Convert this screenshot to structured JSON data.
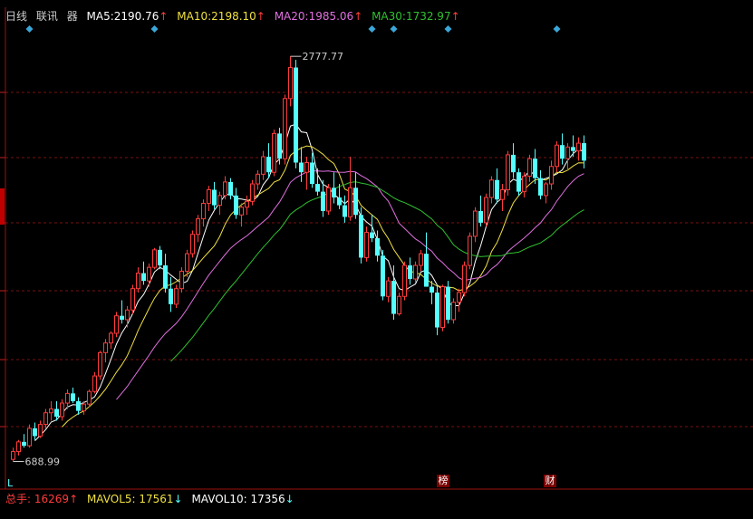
{
  "header": {
    "period": "日线",
    "source": "联讯",
    "tool": "器",
    "ma5": {
      "label": "MA5:",
      "value": "2190.76",
      "arrow": "↑",
      "color": "#ffffff"
    },
    "ma10": {
      "label": "MA10:",
      "value": "2198.10",
      "arrow": "↑",
      "color": "#f0e040"
    },
    "ma20": {
      "label": "MA20:",
      "value": "1985.06",
      "arrow": "↑",
      "color": "#e070e0"
    },
    "ma30": {
      "label": "MA30:",
      "value": "1732.97",
      "arrow": "↑",
      "color": "#30c030"
    }
  },
  "footer": {
    "vol_label": "总手:",
    "vol_value": "16269",
    "vol_arrow": "↑",
    "mavol5": "MAVOL5: 17561",
    "mavol5_arrow": "↓",
    "mavol10": "MAVOL10: 17356",
    "mavol10_arrow": "↓"
  },
  "markers": {
    "bang": "榜",
    "cai": "财"
  },
  "corner": "L",
  "annotations": {
    "high": "2777.77",
    "low": "688.99"
  },
  "colors": {
    "up": "#ff3c3c",
    "down": "#54ffff",
    "grid": "#7a1010",
    "axis": "#a01010",
    "marker": "#3aa7d8"
  },
  "chart_data": {
    "type": "candlestick",
    "title": "",
    "high": 2777.77,
    "low": 688.99,
    "ylim": [
      640,
      2900
    ],
    "n_bars": 106,
    "ohlc": [
      [
        700,
        760,
        689,
        740
      ],
      [
        740,
        800,
        720,
        790
      ],
      [
        790,
        830,
        760,
        770
      ],
      [
        770,
        880,
        760,
        860
      ],
      [
        860,
        890,
        800,
        820
      ],
      [
        820,
        900,
        810,
        880
      ],
      [
        880,
        960,
        860,
        940
      ],
      [
        940,
        1000,
        900,
        960
      ],
      [
        960,
        1000,
        900,
        920
      ],
      [
        920,
        1010,
        900,
        990
      ],
      [
        990,
        1060,
        960,
        1040
      ],
      [
        1040,
        1070,
        990,
        1000
      ],
      [
        1000,
        1020,
        930,
        950
      ],
      [
        950,
        1000,
        930,
        985
      ],
      [
        985,
        1060,
        970,
        1050
      ],
      [
        1050,
        1150,
        1040,
        1130
      ],
      [
        1130,
        1260,
        1110,
        1250
      ],
      [
        1250,
        1320,
        1200,
        1300
      ],
      [
        1300,
        1360,
        1270,
        1350
      ],
      [
        1350,
        1460,
        1330,
        1440
      ],
      [
        1440,
        1520,
        1400,
        1420
      ],
      [
        1420,
        1490,
        1380,
        1470
      ],
      [
        1470,
        1600,
        1450,
        1580
      ],
      [
        1580,
        1690,
        1560,
        1660
      ],
      [
        1660,
        1720,
        1600,
        1620
      ],
      [
        1620,
        1710,
        1590,
        1690
      ],
      [
        1690,
        1790,
        1680,
        1780
      ],
      [
        1780,
        1800,
        1680,
        1700
      ],
      [
        1700,
        1760,
        1560,
        1580
      ],
      [
        1580,
        1640,
        1460,
        1500
      ],
      [
        1500,
        1600,
        1480,
        1580
      ],
      [
        1580,
        1690,
        1560,
        1670
      ],
      [
        1670,
        1780,
        1640,
        1760
      ],
      [
        1760,
        1880,
        1740,
        1860
      ],
      [
        1860,
        1960,
        1820,
        1940
      ],
      [
        1940,
        2040,
        1900,
        2020
      ],
      [
        2020,
        2110,
        1980,
        2090
      ],
      [
        2090,
        2130,
        1990,
        2010
      ],
      [
        2010,
        2080,
        1960,
        2060
      ],
      [
        2060,
        2160,
        2040,
        2130
      ],
      [
        2130,
        2150,
        2040,
        2060
      ],
      [
        2060,
        2100,
        1940,
        1960
      ],
      [
        1960,
        2020,
        1900,
        2000
      ],
      [
        2000,
        2060,
        1960,
        2030
      ],
      [
        2030,
        2140,
        2010,
        2120
      ],
      [
        2120,
        2190,
        2090,
        2170
      ],
      [
        2170,
        2290,
        2140,
        2260
      ],
      [
        2260,
        2330,
        2150,
        2180
      ],
      [
        2180,
        2400,
        2160,
        2380
      ],
      [
        2380,
        2410,
        2220,
        2250
      ],
      [
        2250,
        2580,
        2220,
        2560
      ],
      [
        2560,
        2778,
        2520,
        2720
      ],
      [
        2720,
        2760,
        2200,
        2230
      ],
      [
        2230,
        2310,
        2130,
        2180
      ],
      [
        2180,
        2260,
        2090,
        2230
      ],
      [
        2230,
        2280,
        2100,
        2120
      ],
      [
        2120,
        2200,
        2060,
        2080
      ],
      [
        2080,
        2140,
        1950,
        1980
      ],
      [
        1980,
        2120,
        1960,
        2100
      ],
      [
        2100,
        2180,
        2020,
        2050
      ],
      [
        2050,
        2120,
        1990,
        2010
      ],
      [
        2010,
        2060,
        1920,
        1950
      ],
      [
        1950,
        2260,
        1930,
        2100
      ],
      [
        2100,
        2180,
        1940,
        1960
      ],
      [
        1960,
        2000,
        1710,
        1740
      ],
      [
        1740,
        1900,
        1720,
        1870
      ],
      [
        1870,
        1960,
        1820,
        1840
      ],
      [
        1840,
        1880,
        1720,
        1750
      ],
      [
        1750,
        1780,
        1520,
        1540
      ],
      [
        1540,
        1640,
        1510,
        1620
      ],
      [
        1620,
        1700,
        1420,
        1450
      ],
      [
        1450,
        1560,
        1440,
        1540
      ],
      [
        1540,
        1720,
        1520,
        1700
      ],
      [
        1700,
        1740,
        1600,
        1630
      ],
      [
        1630,
        1720,
        1610,
        1700
      ],
      [
        1700,
        1780,
        1670,
        1760
      ],
      [
        1760,
        1870,
        1740,
        1590
      ],
      [
        1590,
        1620,
        1500,
        1560
      ],
      [
        1560,
        1600,
        1340,
        1380
      ],
      [
        1380,
        1600,
        1360,
        1590
      ],
      [
        1590,
        1620,
        1400,
        1420
      ],
      [
        1420,
        1530,
        1400,
        1510
      ],
      [
        1510,
        1580,
        1460,
        1560
      ],
      [
        1560,
        1720,
        1540,
        1700
      ],
      [
        1700,
        1870,
        1680,
        1850
      ],
      [
        1850,
        2000,
        1820,
        1980
      ],
      [
        1980,
        2060,
        1900,
        1920
      ],
      [
        1920,
        2070,
        1900,
        2050
      ],
      [
        2050,
        2160,
        2020,
        2140
      ],
      [
        2140,
        2200,
        2020,
        2040
      ],
      [
        2040,
        2120,
        1980,
        2090
      ],
      [
        2090,
        2290,
        2060,
        2270
      ],
      [
        2270,
        2330,
        2150,
        2180
      ],
      [
        2180,
        2200,
        2060,
        2080
      ],
      [
        2080,
        2180,
        2050,
        2160
      ],
      [
        2160,
        2270,
        2130,
        2250
      ],
      [
        2250,
        2300,
        2120,
        2150
      ],
      [
        2150,
        2190,
        2040,
        2060
      ],
      [
        2060,
        2130,
        2020,
        2120
      ],
      [
        2120,
        2240,
        2090,
        2210
      ],
      [
        2210,
        2340,
        2180,
        2320
      ],
      [
        2320,
        2380,
        2220,
        2250
      ],
      [
        2250,
        2330,
        2190,
        2310
      ],
      [
        2310,
        2370,
        2260,
        2290
      ],
      [
        2290,
        2360,
        2240,
        2330
      ],
      [
        2330,
        2370,
        2200,
        2240
      ]
    ]
  }
}
